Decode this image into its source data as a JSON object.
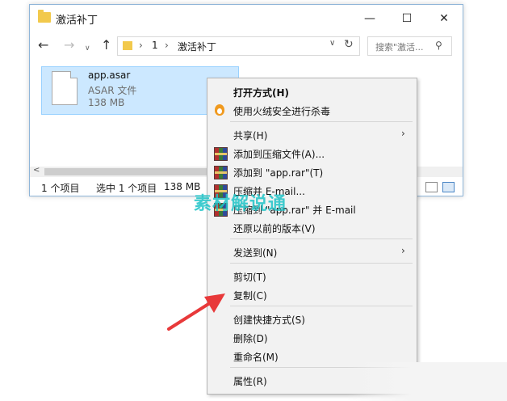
{
  "window": {
    "title": "激活补丁",
    "minimize_glyph": "—",
    "maximize_glyph": "☐",
    "close_glyph": "✕"
  },
  "nav": {
    "back_glyph": "←",
    "forward_glyph": "→",
    "recent_glyph": "∨",
    "up_glyph": "↑",
    "breadcrumb": [
      "1",
      "激活补丁"
    ],
    "breadcrumb_sep": "›",
    "dropdown_glyph": "∨",
    "refresh_glyph": "↻",
    "search_placeholder": "搜索\"激活...",
    "search_glyph": "⚲"
  },
  "file": {
    "name": "app.asar",
    "type": "ASAR 文件",
    "size": "138 MB"
  },
  "scroll": {
    "left_glyph": "<"
  },
  "status": {
    "item_count": "1 个项目",
    "selected": "选中 1 个项目",
    "selected_size": "138 MB"
  },
  "menu": {
    "open_with": "打开方式(H)",
    "scan": "使用火绒安全进行杀毒",
    "share": "共享(H)",
    "add_archive": "添加到压缩文件(A)...",
    "add_rar": "添加到 \"app.rar\"(T)",
    "compress_email": "压缩并 E-mail...",
    "compress_rar_email": "压缩到 \"app.rar\" 并 E-mail",
    "restore": "还原以前的版本(V)",
    "send_to": "发送到(N)",
    "cut": "剪切(T)",
    "copy": "复制(C)",
    "create_shortcut": "创建快捷方式(S)",
    "delete": "删除(D)",
    "rename": "重命名(M)",
    "properties": "属性(R)",
    "chevron": "›"
  },
  "watermark": "素材解说通",
  "colors": {
    "selection": "#cce8ff",
    "arrow": "#e8393a",
    "watermark": "#1fc4c7"
  }
}
